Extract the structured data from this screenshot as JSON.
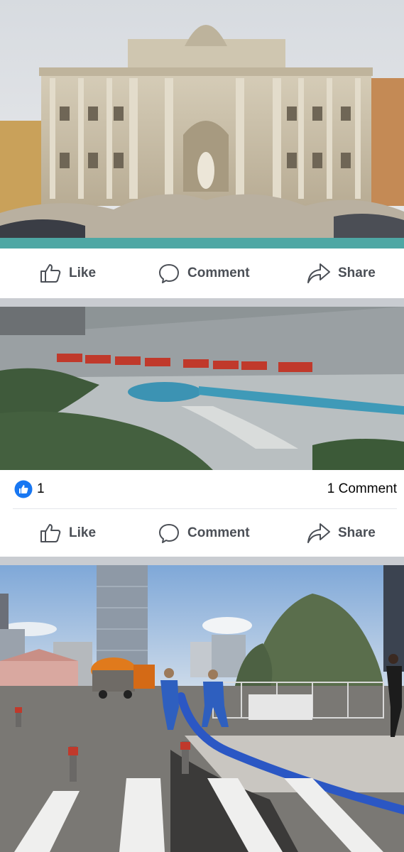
{
  "post1": {
    "actions": {
      "like": "Like",
      "comment": "Comment",
      "share": "Share"
    }
  },
  "post2": {
    "reactions": {
      "count": "1",
      "comments": "1 Comment"
    },
    "actions": {
      "like": "Like",
      "comment": "Comment",
      "share": "Share"
    }
  },
  "colors": {
    "like_blue": "#1877f2",
    "action_gray": "#4b4f56",
    "separator": "#c9ccd1"
  },
  "icons": [
    "thumbs-up-icon",
    "comment-bubble-icon",
    "share-arrow-icon"
  ]
}
